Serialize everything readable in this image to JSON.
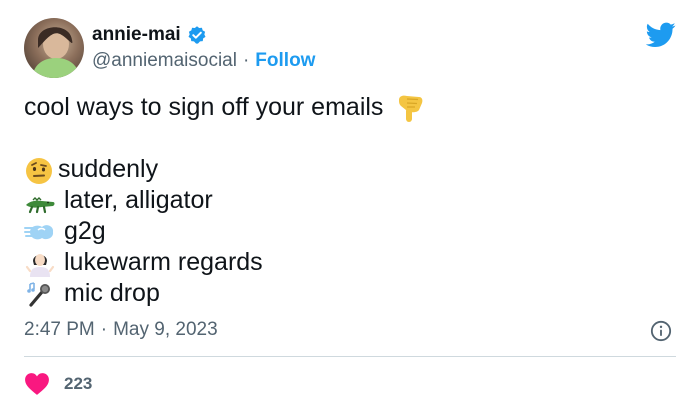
{
  "author": {
    "display_name": "annie-mai",
    "handle": "@anniemaisocial",
    "follow_label": "Follow"
  },
  "tweet": {
    "text_intro": "cool ways to sign off your emails",
    "sign_offs": [
      {
        "icon": "raised-eyebrow-face-icon",
        "label": "suddenly"
      },
      {
        "icon": "crocodile-icon",
        "label": "later, alligator"
      },
      {
        "icon": "dash-icon",
        "label": "g2g"
      },
      {
        "icon": "person-shrugging-icon",
        "label": "lukewarm regards"
      },
      {
        "icon": "microphone-icon",
        "label": "mic drop"
      }
    ],
    "time": "2:47 PM",
    "date": "May 9, 2023",
    "likes": "223"
  },
  "colors": {
    "accent": "#1d9bf0",
    "secondary_text": "#536471",
    "like": "#f91880"
  }
}
